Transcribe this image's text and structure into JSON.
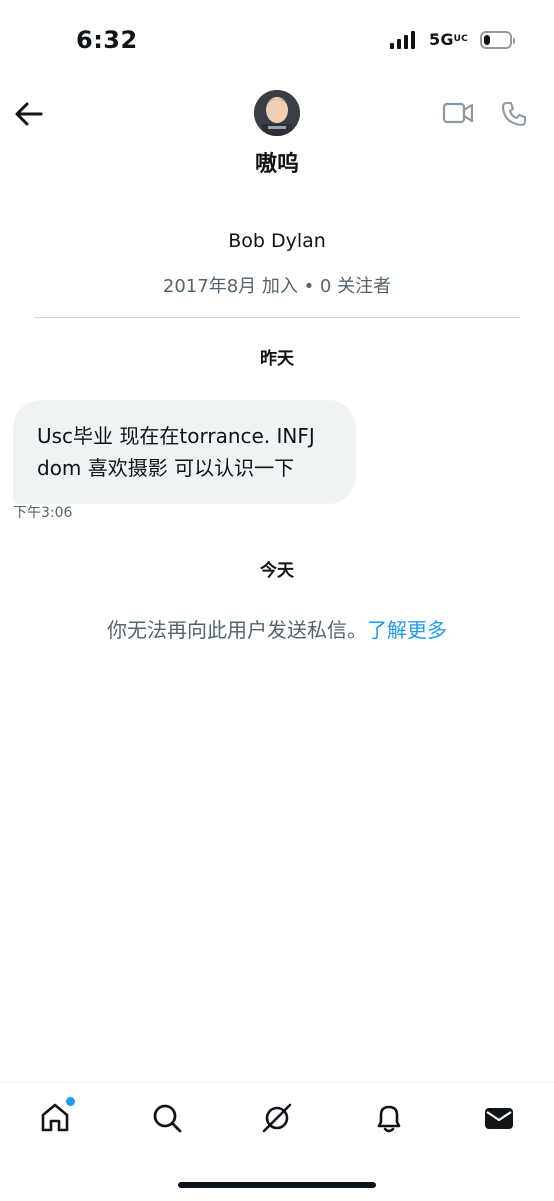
{
  "status_bar": {
    "time": "6:32",
    "network": "5G",
    "network_suffix": "UC",
    "battery_level": 0.25
  },
  "header": {
    "name": "嗷呜",
    "icons": {
      "back": "arrow-left-icon",
      "video": "video-camera-icon",
      "call": "phone-icon"
    }
  },
  "profile": {
    "display_name": "Bob Dylan",
    "meta": "2017年8月 加入 • 0 关注者"
  },
  "conversation": {
    "day_1": "昨天",
    "message_1": {
      "text": "Usc毕业 现在在torrance. INFJ dom 喜欢摄影 可以认识一下",
      "time": "下午3:06"
    },
    "day_2": "今天",
    "notice": "你无法再向此用户发送私信。",
    "notice_link": "了解更多"
  },
  "bottom_nav": {
    "items": [
      "home-icon",
      "search-icon",
      "grok-icon",
      "notifications-bell-icon",
      "messages-envelope-icon"
    ],
    "home_has_badge": true
  },
  "colors": {
    "accent": "#1d9bf0",
    "muted_text": "#536471",
    "bubble": "#eff3f4",
    "divider": "#cfd9de"
  }
}
